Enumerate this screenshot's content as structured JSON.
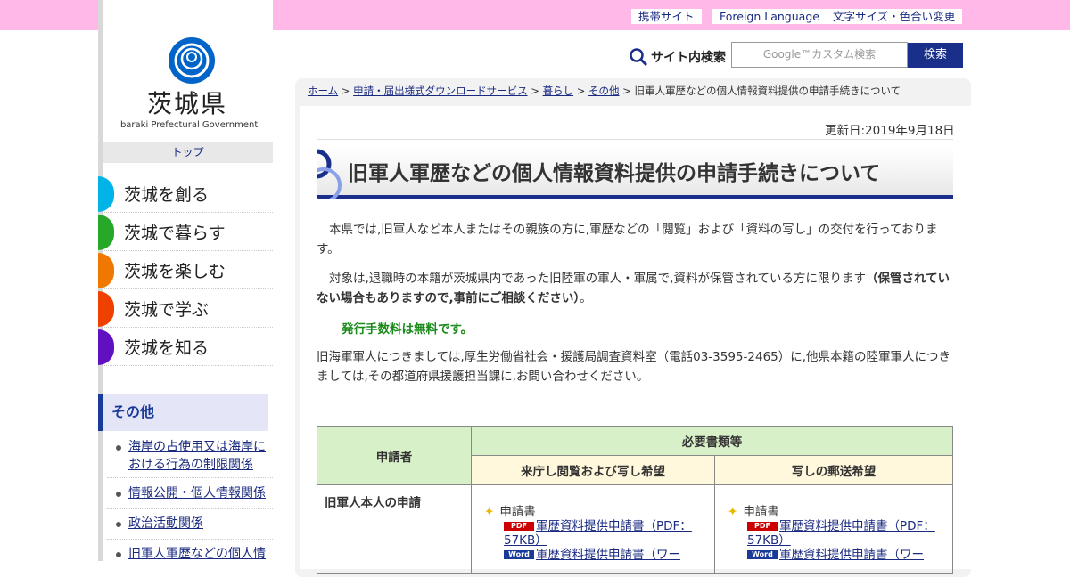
{
  "header": {
    "links": [
      "携帯サイト",
      "Foreign Language",
      "文字サイズ・色合い変更"
    ],
    "search_label": "サイト内検索",
    "search_placeholder": "Google™カスタム検索",
    "search_button": "検索"
  },
  "sidebar": {
    "logo_title": "茨城県",
    "logo_sub": "Ibaraki Prefectural Government",
    "top_label": "トップ",
    "nav": [
      {
        "label": "茨城を創る",
        "color": "#00b4e8"
      },
      {
        "label": "茨城で暮らす",
        "color": "#28a828"
      },
      {
        "label": "茨城を楽しむ",
        "color": "#f07800"
      },
      {
        "label": "茨城で学ぶ",
        "color": "#f04000"
      },
      {
        "label": "茨城を知る",
        "color": "#6010c0"
      }
    ],
    "section_title": "その他",
    "sub_items": [
      "海岸の占使用又は海岸における行為の制限関係",
      "情報公開・個人情報関係",
      "政治活動関係",
      "旧軍人軍歴などの個人情"
    ]
  },
  "breadcrumb": {
    "items": [
      "ホーム",
      "申請・届出様式ダウンロードサービス",
      "暮らし",
      "その他"
    ],
    "current": "旧軍人軍歴などの個人情報資料提供の申請手続きについて"
  },
  "main": {
    "updated": "更新日:2019年9月18日",
    "title": "旧軍人軍歴などの個人情報資料提供の申請手続きについて",
    "para1": "本県では,旧軍人など本人またはその親族の方に,軍歴などの「閲覧」および「資料の写し」の交付を行っております。",
    "para2_normal": "対象は,退職時の本籍が茨城県内であった旧陸軍の軍人・軍属で,資料が保管されている方に限ります",
    "para2_bold": "（保管されていない場合もありますので,事前にご相談ください）",
    "para2_end": "。",
    "fee_note": "発行手数料は無料です。",
    "para3": "旧海軍軍人につきましては,厚生労働省社会・援護局調査資料室（電話03-3595-2465）に,他県本籍の陸軍軍人につきましては,その都道府県援護担当課に,お問い合わせください。"
  },
  "table": {
    "h_applicant": "申請者",
    "h_docs": "必要書類等",
    "h_visit": "来庁し閲覧および写し希望",
    "h_mail": "写しの郵送希望",
    "row1_applicant": "旧軍人本人の申請",
    "doc_label": "申請書",
    "pdf_badge": "PDF",
    "word_badge": "Word",
    "pdf_link": "軍歴資料提供申請書（PDF：57KB）",
    "word_link": "軍歴資料提供申請書（ワー"
  }
}
